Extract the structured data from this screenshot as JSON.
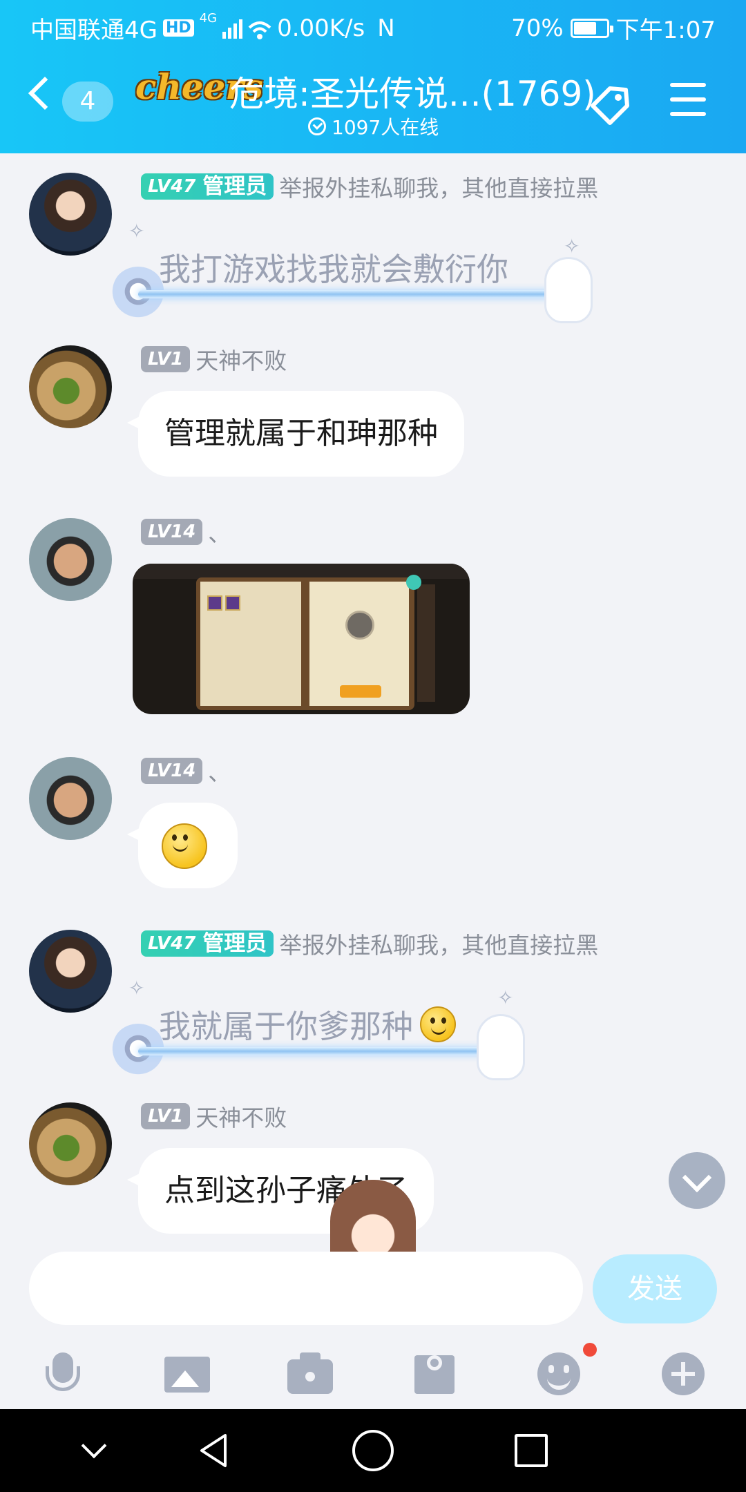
{
  "status_bar": {
    "carrier": "中国联通4G",
    "hd": "HD",
    "net_type": "4G",
    "speed": "0.00K/s",
    "nfc": "N",
    "battery_pct": "70%",
    "battery_level": 0.7,
    "time": "下午1:07"
  },
  "header": {
    "unread_count": "4",
    "logo": "cheers",
    "title": "危境:圣光传说...(1769)",
    "online": "1097人在线"
  },
  "messages": [
    {
      "level": "LV47",
      "role": "管理员",
      "name": "举报外挂私聊我，其他直接拉黑",
      "text": "我打游戏找我就会敷衍你"
    },
    {
      "level": "LV1",
      "name": "天神不败",
      "text": "管理就属于和珅那种"
    },
    {
      "level": "LV14",
      "name": "、"
    },
    {
      "level": "LV14",
      "name": "、"
    },
    {
      "level": "LV47",
      "role": "管理员",
      "name": "举报外挂私聊我，其他直接拉黑",
      "text": "我就属于你爹那种"
    },
    {
      "level": "LV1",
      "name": "天神不败",
      "text": "点到这孙子痛处了"
    }
  ],
  "input": {
    "placeholder": "",
    "send_label": "发送"
  },
  "colors": {
    "header_start": "#18c6f7",
    "header_end": "#1aa8f2",
    "admin_badge": "#35d0b2",
    "send_button": "#b8ecff",
    "notify_dot": "#f04a3a"
  }
}
